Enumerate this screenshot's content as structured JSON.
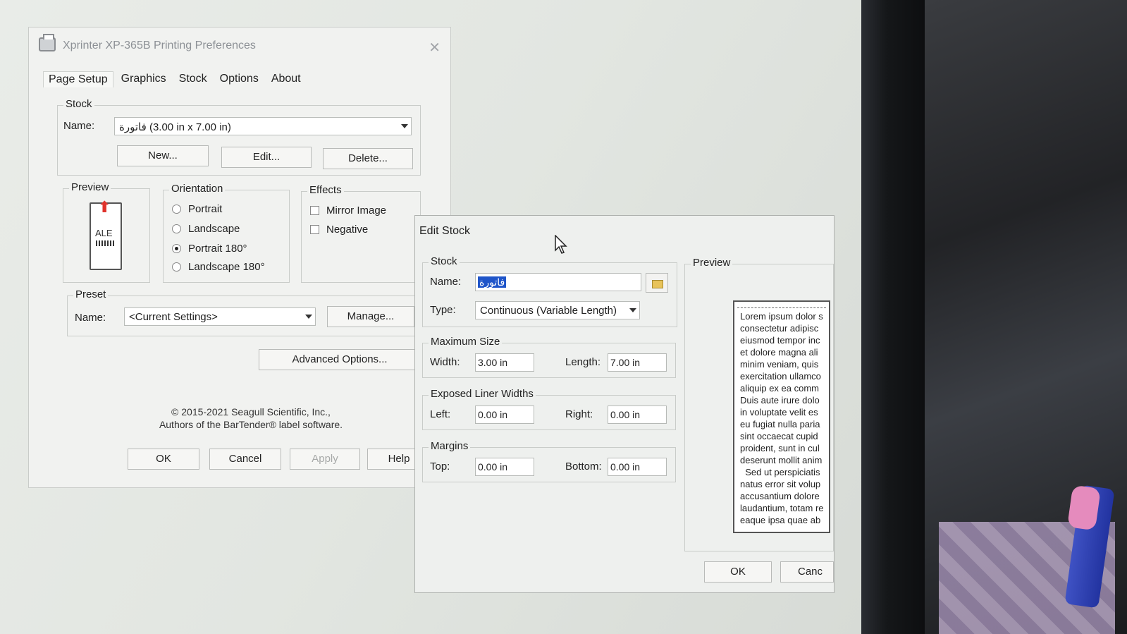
{
  "main_dialog": {
    "title": "Xprinter XP-365B Printing Preferences",
    "tabs": [
      "Page Setup",
      "Graphics",
      "Stock",
      "Options",
      "About"
    ],
    "active_tab": "Page Setup",
    "stock": {
      "group_label": "Stock",
      "name_label": "Name:",
      "name_value": "فاتورة (3.00 in x 7.00 in)",
      "new_label": "New...",
      "edit_label": "Edit...",
      "delete_label": "Delete..."
    },
    "preview": {
      "group_label": "Preview",
      "label_text": "ALE"
    },
    "orientation": {
      "group_label": "Orientation",
      "options": [
        "Portrait",
        "Landscape",
        "Portrait 180°",
        "Landscape 180°"
      ],
      "selected": "Portrait 180°"
    },
    "effects": {
      "group_label": "Effects",
      "options": [
        "Mirror Image",
        "Negative"
      ]
    },
    "preset": {
      "group_label": "Preset",
      "name_label": "Name:",
      "name_value": "<Current Settings>",
      "manage_label": "Manage..."
    },
    "advanced_label": "Advanced Options...",
    "copyright_line1": "© 2015-2021 Seagull Scientific, Inc.,",
    "copyright_line2": "Authors of the BarTender® label software.",
    "buttons": {
      "ok": "OK",
      "cancel": "Cancel",
      "apply": "Apply",
      "help": "Help"
    }
  },
  "edit_stock": {
    "title": "Edit Stock",
    "stock": {
      "group_label": "Stock",
      "name_label": "Name:",
      "name_value": "فاتورة",
      "type_label": "Type:",
      "type_value": "Continuous (Variable Length)"
    },
    "maximum_size": {
      "group_label": "Maximum Size",
      "width_label": "Width:",
      "width_value": "3.00 in",
      "length_label": "Length:",
      "length_value": "7.00 in"
    },
    "exposed_liner_widths": {
      "group_label": "Exposed Liner Widths",
      "left_label": "Left:",
      "left_value": "0.00 in",
      "right_label": "Right:",
      "right_value": "0.00 in"
    },
    "margins": {
      "group_label": "Margins",
      "top_label": "Top:",
      "top_value": "0.00 in",
      "bottom_label": "Bottom:",
      "bottom_value": "0.00 in"
    },
    "preview": {
      "group_label": "Preview",
      "text": "Lorem ipsum dolor s\nconsectetur adipisc\neiusmod tempor inc\net dolore magna ali\nminim veniam, quis\nexercitation ullamco\naliquip ex ea comm\nDuis aute irure dolo\nin voluptate velit es\neu fugiat nulla paria\nsint occaecat cupid\nproident, sunt in cul\ndeserunt mollit anim\n  Sed ut perspiciatis\nnatus error sit volup\naccusantium dolore\nlaudantium, totam re\neaque ipsa quae ab"
    },
    "buttons": {
      "ok": "OK",
      "cancel": "Canc"
    }
  }
}
